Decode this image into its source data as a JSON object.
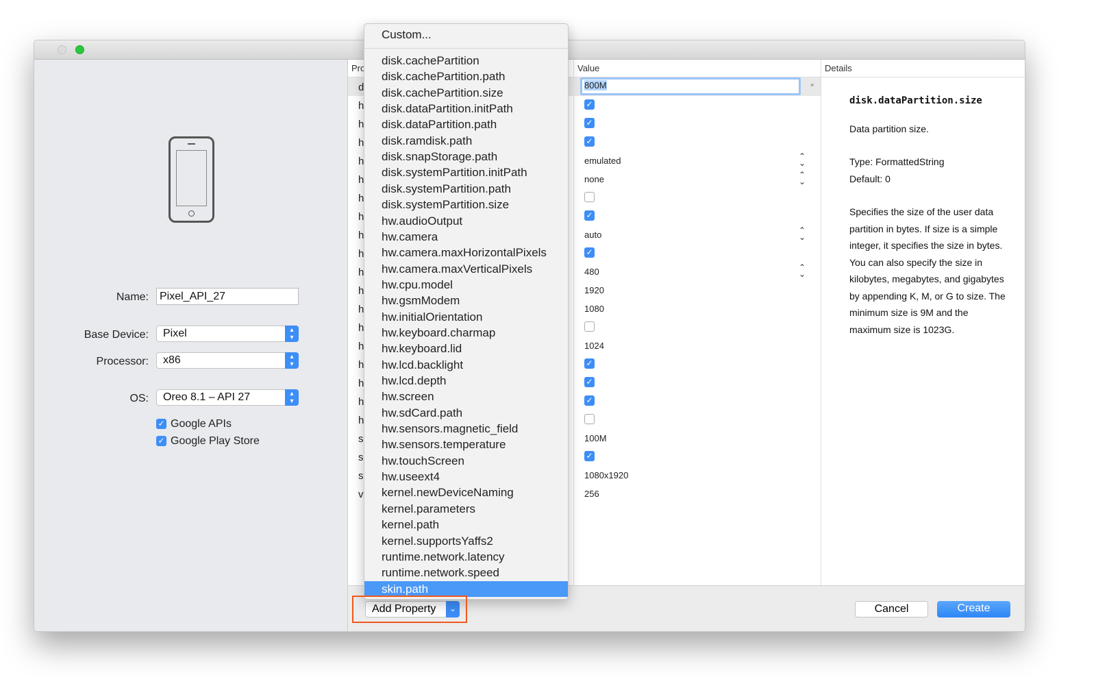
{
  "window": {
    "controls": [
      "close",
      "zoom"
    ]
  },
  "left": {
    "name_label": "Name:",
    "name_value": "Pixel_API_27",
    "base_label": "Base Device:",
    "base_value": "Pixel",
    "proc_label": "Processor:",
    "proc_value": "x86",
    "os_label": "OS:",
    "os_value": "Oreo 8.1 – API 27",
    "google_apis": "Google APIs",
    "google_play": "Google Play Store"
  },
  "table": {
    "col_property": "Pro",
    "col_value": "Value",
    "col_details": "Details",
    "rows": [
      {
        "p": "d",
        "type": "text",
        "v": "800M"
      },
      {
        "p": "h",
        "type": "check",
        "v": true
      },
      {
        "p": "h",
        "type": "check",
        "v": true
      },
      {
        "p": "h",
        "type": "check",
        "v": true
      },
      {
        "p": "h",
        "type": "select",
        "v": "emulated"
      },
      {
        "p": "h",
        "type": "select",
        "v": "none"
      },
      {
        "p": "h",
        "type": "check",
        "v": false
      },
      {
        "p": "h",
        "type": "check",
        "v": true
      },
      {
        "p": "h",
        "type": "select",
        "v": "auto"
      },
      {
        "p": "h",
        "type": "check",
        "v": true
      },
      {
        "p": "h",
        "type": "select",
        "v": "480"
      },
      {
        "p": "h",
        "type": "text",
        "v": "1920"
      },
      {
        "p": "h",
        "type": "text",
        "v": "1080"
      },
      {
        "p": "h",
        "type": "check",
        "v": false
      },
      {
        "p": "h",
        "type": "text",
        "v": "1024"
      },
      {
        "p": "h",
        "type": "check",
        "v": true
      },
      {
        "p": "h",
        "type": "check",
        "v": true
      },
      {
        "p": "h",
        "type": "check",
        "v": true
      },
      {
        "p": "h",
        "type": "check",
        "v": false
      },
      {
        "p": "s",
        "type": "text",
        "v": "100M"
      },
      {
        "p": "sl",
        "type": "check",
        "v": true
      },
      {
        "p": "sl",
        "type": "text",
        "v": "1080x1920"
      },
      {
        "p": "v",
        "type": "text",
        "v": "256"
      }
    ]
  },
  "details": {
    "title": "disk.dataPartition.size",
    "summary": "Data partition size.",
    "type": "Type: FormattedString",
    "default": "Default: 0",
    "description": "Specifies the size of the user data partition in bytes. If size is a simple integer, it specifies the size in bytes. You can also specify the size in kilobytes, megabytes, and gigabytes by appending K, M, or G to size. The minimum size is 9M and the maximum size is 1023G."
  },
  "menu": {
    "custom": "Custom...",
    "selected": "skin.path",
    "items": [
      "disk.cachePartition",
      "disk.cachePartition.path",
      "disk.cachePartition.size",
      "disk.dataPartition.initPath",
      "disk.dataPartition.path",
      "disk.ramdisk.path",
      "disk.snapStorage.path",
      "disk.systemPartition.initPath",
      "disk.systemPartition.path",
      "disk.systemPartition.size",
      "hw.audioOutput",
      "hw.camera",
      "hw.camera.maxHorizontalPixels",
      "hw.camera.maxVerticalPixels",
      "hw.cpu.model",
      "hw.gsmModem",
      "hw.initialOrientation",
      "hw.keyboard.charmap",
      "hw.keyboard.lid",
      "hw.lcd.backlight",
      "hw.lcd.depth",
      "hw.screen",
      "hw.sdCard.path",
      "hw.sensors.magnetic_field",
      "hw.sensors.temperature",
      "hw.touchScreen",
      "hw.useext4",
      "kernel.newDeviceNaming",
      "kernel.parameters",
      "kernel.path",
      "kernel.supportsYaffs2",
      "runtime.network.latency",
      "runtime.network.speed",
      "skin.path"
    ]
  },
  "buttons": {
    "add_property": "Add Property",
    "cancel": "Cancel",
    "create": "Create"
  },
  "colors": {
    "accent": "#3d8ef7",
    "highlight": "#f0591f"
  }
}
